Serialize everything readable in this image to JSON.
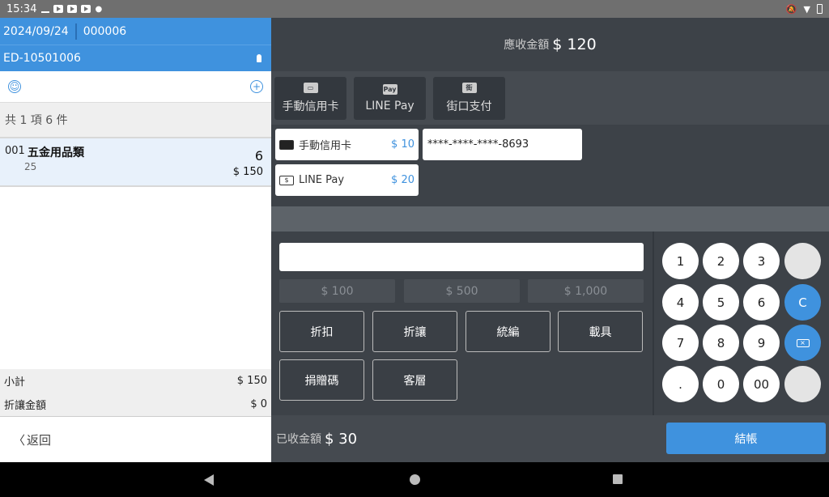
{
  "status_bar": {
    "time": "15:34"
  },
  "order": {
    "date": "2024/09/24",
    "number": "000006",
    "staff_id": "ED-10501006",
    "summary": "共 1 項 6 件",
    "items": [
      {
        "no": "001",
        "name": "五金用品類",
        "sub": "25",
        "qty": "6",
        "price": "$ 150"
      }
    ],
    "subtotal_label": "小計",
    "subtotal_value": "$ 150",
    "discount_label": "折讓金額",
    "discount_value": "$ 0",
    "back_label": "返回"
  },
  "payment": {
    "due_label": "應收金額",
    "due_value": "$ 120",
    "methods": [
      {
        "icon": "LINE",
        "label": "手動信用卡"
      },
      {
        "icon": "Pay",
        "label": "LINE Pay"
      },
      {
        "icon": "街",
        "label": "街口支付"
      }
    ],
    "method_icons": {
      "manual_card": "card-icon",
      "line_pay": "line-pay-icon",
      "jkos": "jkos-icon"
    },
    "applied": [
      {
        "label": "手動信用卡",
        "value": "$ 10"
      },
      {
        "label": "LINE Pay",
        "value": "$ 20"
      }
    ],
    "card_number": "****-****-****-8693",
    "amount_input_value": "",
    "quick_amounts": [
      "$ 100",
      "$ 500",
      "$ 1,000"
    ],
    "functions": [
      "折扣",
      "折讓",
      "統編",
      "載具",
      "捐贈碼",
      "客層"
    ],
    "keypad": [
      "1",
      "2",
      "3",
      "4",
      "5",
      "6",
      "C",
      "7",
      "8",
      "9",
      ".",
      "0",
      "00"
    ],
    "received_label": "已收金額",
    "received_value": "$ 30",
    "checkout_label": "結帳"
  },
  "colors": {
    "accent": "#3f92de",
    "panel": "#3a3f45"
  }
}
